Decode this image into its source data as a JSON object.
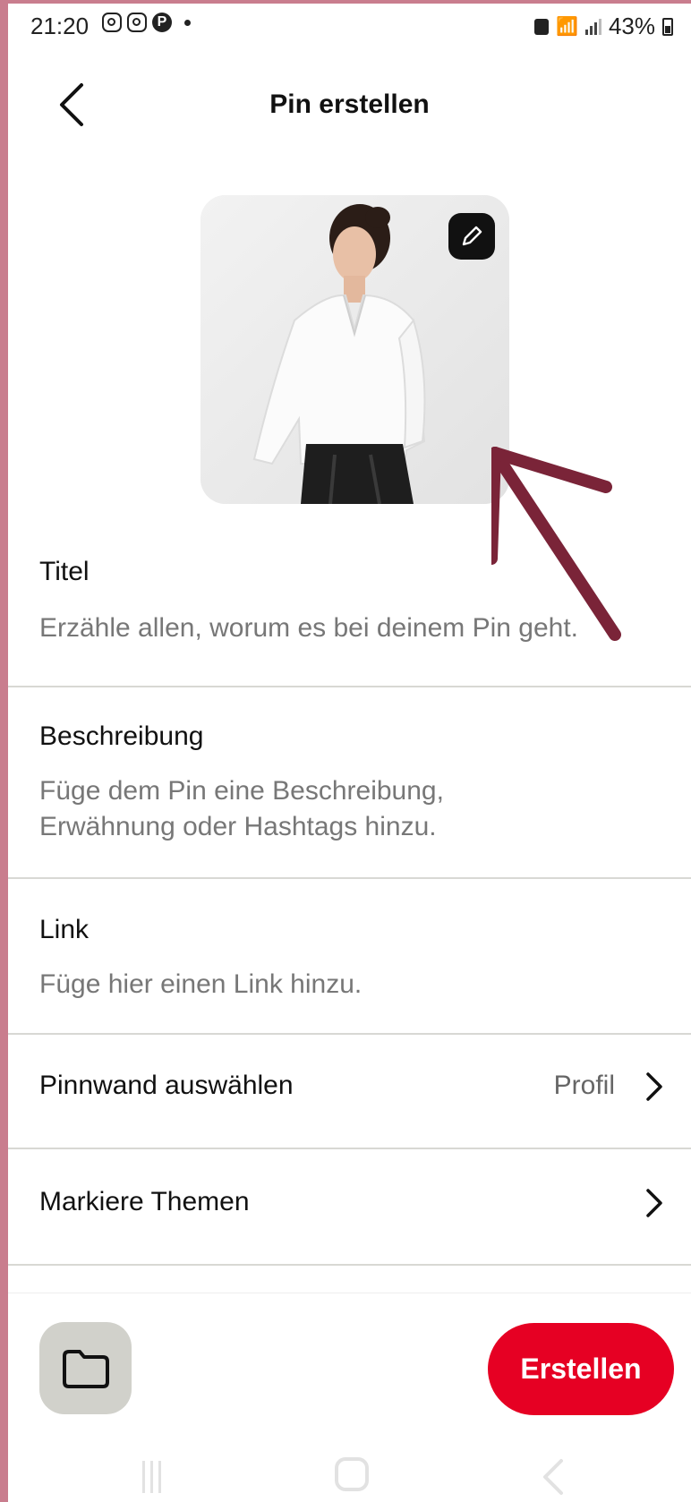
{
  "status_bar": {
    "time": "21:20",
    "battery": "43%"
  },
  "header": {
    "title": "Pin erstellen"
  },
  "form": {
    "title": {
      "label": "Titel",
      "placeholder": "Erzähle allen, worum es bei deinem Pin geht."
    },
    "description": {
      "label": "Beschreibung",
      "placeholder_line1": "Füge dem Pin eine Beschreibung,",
      "placeholder_line2": "Erwähnung oder Hashtags hinzu."
    },
    "link": {
      "label": "Link",
      "placeholder": "Füge hier einen Link hinzu."
    },
    "board": {
      "label": "Pinnwand auswählen",
      "value": "Profil"
    },
    "topics": {
      "label": "Markiere Themen"
    }
  },
  "footer": {
    "create_label": "Erstellen"
  },
  "colors": {
    "accent": "#e60023",
    "annotation_arrow": "#7a2438",
    "frame": "#c97d8e"
  }
}
